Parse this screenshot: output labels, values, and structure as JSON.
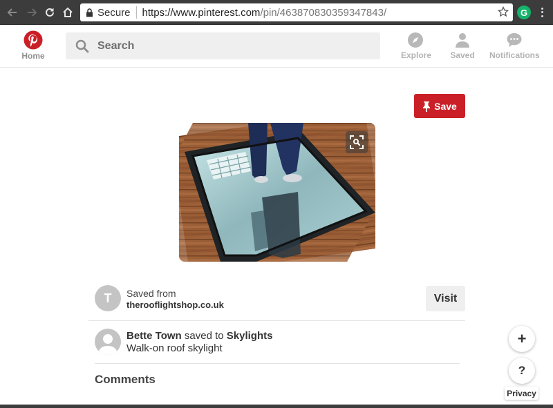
{
  "browser": {
    "secure_label": "Secure",
    "url_host": "https://www.pinterest.com",
    "url_path": "/pin/463870830359347843/",
    "extension_letter": "G"
  },
  "header": {
    "home_label": "Home",
    "search_placeholder": "Search",
    "nav": [
      {
        "label": "Explore",
        "icon": "compass-icon"
      },
      {
        "label": "Saved",
        "icon": "person-icon"
      },
      {
        "label": "Notifications",
        "icon": "speech-bubble-icon"
      }
    ]
  },
  "pin": {
    "save_label": "Save",
    "image_description": "",
    "saved_from_label": "Saved from",
    "source_domain": "therooflightshop.co.uk",
    "source_avatar_letter": "T",
    "visit_label": "Visit",
    "saver_name": "Bette Town",
    "saved_to_text": "saved to",
    "board_name": "Skylights",
    "description": "Walk-on roof skylight"
  },
  "comments": {
    "title": "Comments"
  },
  "floating": {
    "plus": "+",
    "help": "?",
    "privacy_label": "Privacy"
  },
  "colors": {
    "pinterest_red": "#cb1f27",
    "chrome_bg": "#3c3c3c",
    "grammarly_green": "#15b36a"
  }
}
